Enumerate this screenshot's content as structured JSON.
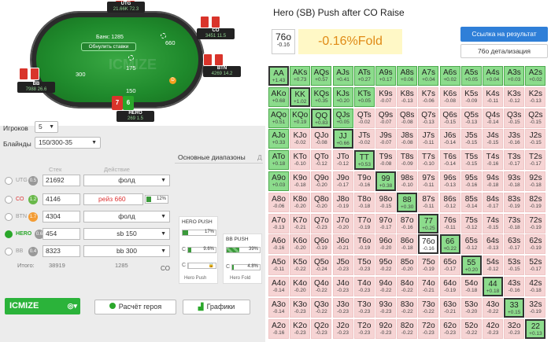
{
  "table": {
    "bank_label": "Банк: 1285",
    "reset_label": "Обнулить ставки",
    "watermark": "ICMIZE",
    "chip_values": {
      "co": "660",
      "hero": "150",
      "bb": "300",
      "center": "175"
    },
    "dealer_label": "D",
    "players": [
      {
        "id": "utg",
        "name": "UTG",
        "stack": "21.66K",
        "bb": "72.3"
      },
      {
        "id": "co",
        "name": "CO",
        "stack": "3451",
        "bb": "11.5"
      },
      {
        "id": "btn",
        "name": "BTN",
        "stack": "4269",
        "bb": "14.2"
      },
      {
        "id": "hero",
        "name": "HERO",
        "stack": "269",
        "bb": "1.5"
      },
      {
        "id": "bb",
        "name": "BB",
        "stack": "7988",
        "bb": "26.6"
      }
    ],
    "hero_cards": [
      "7",
      "6"
    ]
  },
  "controls": {
    "players_label": "Игроков",
    "players_value": "5",
    "blinds_label": "Блайнды",
    "blinds_value": "150/300-35",
    "stack_header": "Стек",
    "action_header": "Действие",
    "total_label": "Итого:",
    "total_stack": "38919",
    "total_pot": "1285",
    "rows": [
      {
        "pos": "UTG",
        "badge": "0.5",
        "stack": "21692",
        "action": "фолд",
        "pct": ""
      },
      {
        "pos": "CO",
        "badge": "1.2",
        "stack": "4146",
        "action": "рейз 660",
        "pct": "12%"
      },
      {
        "pos": "BTN",
        "badge": "1.7",
        "stack": "4304",
        "action": "фолд",
        "pct": ""
      },
      {
        "pos": "HERO",
        "badge": "0.6",
        "stack": "454",
        "action": "sb 150",
        "pct": ""
      },
      {
        "pos": "BB",
        "badge": "0.4",
        "stack": "8323",
        "action": "bb 300",
        "pct": ""
      }
    ],
    "co_footer": "CO"
  },
  "ranges": {
    "tab1": "Основные диапазоны",
    "tab2": "Д",
    "hero_push": {
      "title": "HERO PUSH",
      "top": "17%",
      "c_pct": "9.6%",
      "c_label": "C",
      "caption": "Hero Push"
    },
    "bb_push": {
      "title": "BB PUSH",
      "top": "39%",
      "c_pct": "4.8%",
      "c_label": "C",
      "caption": "Hero Fold"
    }
  },
  "buttons": {
    "icmize": "ICMIZE",
    "hero_calc": "Расчёт героя",
    "charts": "Графики"
  },
  "panel": {
    "title": "Hero (SB) Push after CO Raise",
    "hand": "76o",
    "hand_val": "-0.16",
    "ev": "-0.16%Fold",
    "link_btn": "Ссылка на результат",
    "detail_btn": "76o детализация"
  },
  "grid": [
    [
      [
        "AA",
        "+1.43",
        "p"
      ],
      [
        "AKs",
        "+0.73",
        "p"
      ],
      [
        "AQs",
        "+0.57",
        "p"
      ],
      [
        "AJs",
        "+0.41",
        "p"
      ],
      [
        "ATs",
        "+0.27",
        "p"
      ],
      [
        "A9s",
        "+0.17",
        "p"
      ],
      [
        "A8s",
        "+0.06",
        "p"
      ],
      [
        "A7s",
        "+0.04",
        "p"
      ],
      [
        "A6s",
        "+0.02",
        "p"
      ],
      [
        "A5s",
        "+0.05",
        "p"
      ],
      [
        "A4s",
        "+0.04",
        "p"
      ],
      [
        "A3s",
        "+0.03",
        "p"
      ],
      [
        "A2s",
        "+0.02",
        "p"
      ]
    ],
    [
      [
        "AKo",
        "+0.68",
        "p"
      ],
      [
        "KK",
        "+1.02",
        "p"
      ],
      [
        "KQs",
        "+0.35",
        "p"
      ],
      [
        "KJs",
        "+0.20",
        "p"
      ],
      [
        "KTs",
        "+0.05",
        "p"
      ],
      [
        "K9s",
        "-0.07",
        "f"
      ],
      [
        "K8s",
        "-0.13",
        "f"
      ],
      [
        "K7s",
        "-0.06",
        "f"
      ],
      [
        "K6s",
        "-0.08",
        "f"
      ],
      [
        "K5s",
        "-0.09",
        "f"
      ],
      [
        "K4s",
        "-0.11",
        "f"
      ],
      [
        "K3s",
        "-0.12",
        "f"
      ],
      [
        "K2s",
        "-0.13",
        "f"
      ]
    ],
    [
      [
        "AQo",
        "+0.51",
        "p"
      ],
      [
        "KQo",
        "+0.19",
        "p"
      ],
      [
        "QQ",
        "+0.83",
        "p"
      ],
      [
        "QJs",
        "+0.05",
        "p"
      ],
      [
        "QTs",
        "-0.02",
        "f"
      ],
      [
        "Q9s",
        "-0.07",
        "f"
      ],
      [
        "Q8s",
        "-0.08",
        "f"
      ],
      [
        "Q7s",
        "-0.13",
        "f"
      ],
      [
        "Q6s",
        "-0.15",
        "f"
      ],
      [
        "Q5s",
        "-0.13",
        "f"
      ],
      [
        "Q4s",
        "-0.14",
        "f"
      ],
      [
        "Q3s",
        "-0.15",
        "f"
      ],
      [
        "Q2s",
        "-0.15",
        "f"
      ]
    ],
    [
      [
        "AJo",
        "+0.33",
        "p"
      ],
      [
        "KJo",
        "-0.02",
        "f"
      ],
      [
        "QJo",
        "-0.08",
        "f"
      ],
      [
        "JJ",
        "+0.66",
        "p"
      ],
      [
        "JTs",
        "-0.02",
        "f"
      ],
      [
        "J9s",
        "-0.07",
        "f"
      ],
      [
        "J8s",
        "-0.08",
        "f"
      ],
      [
        "J7s",
        "-0.11",
        "f"
      ],
      [
        "J6s",
        "-0.14",
        "f"
      ],
      [
        "J5s",
        "-0.15",
        "f"
      ],
      [
        "J4s",
        "-0.15",
        "f"
      ],
      [
        "J3s",
        "-0.16",
        "f"
      ],
      [
        "J2s",
        "-0.15",
        "f"
      ]
    ],
    [
      [
        "ATo",
        "+0.18",
        "p"
      ],
      [
        "KTo",
        "-0.10",
        "f"
      ],
      [
        "QTo",
        "-0.12",
        "f"
      ],
      [
        "JTo",
        "-0.12",
        "f"
      ],
      [
        "TT",
        "+0.53",
        "p"
      ],
      [
        "T9s",
        "-0.08",
        "f"
      ],
      [
        "T8s",
        "-0.09",
        "f"
      ],
      [
        "T7s",
        "-0.10",
        "f"
      ],
      [
        "T6s",
        "-0.14",
        "f"
      ],
      [
        "T5s",
        "-0.15",
        "f"
      ],
      [
        "T4s",
        "-0.16",
        "f"
      ],
      [
        "T3s",
        "-0.17",
        "f"
      ],
      [
        "T2s",
        "-0.17",
        "f"
      ]
    ],
    [
      [
        "A9o",
        "+0.03",
        "p"
      ],
      [
        "K9o",
        "-0.18",
        "f"
      ],
      [
        "Q9o",
        "-0.20",
        "f"
      ],
      [
        "J9o",
        "-0.17",
        "f"
      ],
      [
        "T9o",
        "-0.16",
        "f"
      ],
      [
        "99",
        "+0.38",
        "p"
      ],
      [
        "98s",
        "-0.10",
        "f"
      ],
      [
        "97s",
        "-0.11",
        "f"
      ],
      [
        "96s",
        "-0.13",
        "f"
      ],
      [
        "95s",
        "-0.16",
        "f"
      ],
      [
        "94s",
        "-0.18",
        "f"
      ],
      [
        "93s",
        "-0.18",
        "f"
      ],
      [
        "92s",
        "-0.18",
        "f"
      ]
    ],
    [
      [
        "A8o",
        "-0.06",
        "f"
      ],
      [
        "K8o",
        "-0.20",
        "f"
      ],
      [
        "Q8o",
        "-0.20",
        "f"
      ],
      [
        "J8o",
        "-0.19",
        "f"
      ],
      [
        "T8o",
        "-0.18",
        "f"
      ],
      [
        "98o",
        "-0.15",
        "f"
      ],
      [
        "88",
        "+0.30",
        "p"
      ],
      [
        "87s",
        "-0.11",
        "f"
      ],
      [
        "86s",
        "-0.12",
        "f"
      ],
      [
        "85s",
        "-0.14",
        "f"
      ],
      [
        "84s",
        "-0.17",
        "f"
      ],
      [
        "83s",
        "-0.19",
        "f"
      ],
      [
        "82s",
        "-0.19",
        "f"
      ]
    ],
    [
      [
        "A7o",
        "-0.13",
        "f"
      ],
      [
        "K7o",
        "-0.21",
        "f"
      ],
      [
        "Q7o",
        "-0.23",
        "f"
      ],
      [
        "J7o",
        "-0.20",
        "f"
      ],
      [
        "T7o",
        "-0.19",
        "f"
      ],
      [
        "97o",
        "-0.17",
        "f"
      ],
      [
        "87o",
        "-0.16",
        "f"
      ],
      [
        "77",
        "+0.25",
        "p"
      ],
      [
        "76s",
        "-0.11",
        "f"
      ],
      [
        "75s",
        "-0.12",
        "f"
      ],
      [
        "74s",
        "-0.15",
        "f"
      ],
      [
        "73s",
        "-0.18",
        "f"
      ],
      [
        "72s",
        "-0.19",
        "f"
      ]
    ],
    [
      [
        "A6o",
        "-0.16",
        "f"
      ],
      [
        "K6o",
        "-0.20",
        "f"
      ],
      [
        "Q6o",
        "-0.19",
        "f"
      ],
      [
        "J6o",
        "-0.21",
        "f"
      ],
      [
        "T6o",
        "-0.19",
        "f"
      ],
      [
        "96o",
        "-0.20",
        "f"
      ],
      [
        "86o",
        "-0.18",
        "f"
      ],
      [
        "76o",
        "-0.16",
        "hl"
      ],
      [
        "66",
        "+0.22",
        "p"
      ],
      [
        "65s",
        "-0.12",
        "f"
      ],
      [
        "64s",
        "-0.13",
        "f"
      ],
      [
        "63s",
        "-0.17",
        "f"
      ],
      [
        "62s",
        "-0.19",
        "f"
      ]
    ],
    [
      [
        "A5o",
        "-0.11",
        "f"
      ],
      [
        "K5o",
        "-0.22",
        "f"
      ],
      [
        "Q5o",
        "-0.24",
        "f"
      ],
      [
        "J5o",
        "-0.23",
        "f"
      ],
      [
        "T5o",
        "-0.23",
        "f"
      ],
      [
        "95o",
        "-0.22",
        "f"
      ],
      [
        "85o",
        "-0.20",
        "f"
      ],
      [
        "75o",
        "-0.19",
        "f"
      ],
      [
        "65o",
        "-0.17",
        "f"
      ],
      [
        "55",
        "+0.20",
        "p"
      ],
      [
        "54s",
        "-0.12",
        "f"
      ],
      [
        "53s",
        "-0.15",
        "f"
      ],
      [
        "52s",
        "-0.17",
        "f"
      ]
    ],
    [
      [
        "A4o",
        "-0.14",
        "f"
      ],
      [
        "K4o",
        "-0.20",
        "f"
      ],
      [
        "Q4o",
        "-0.22",
        "f"
      ],
      [
        "J4o",
        "-0.23",
        "f"
      ],
      [
        "T4o",
        "-0.23",
        "f"
      ],
      [
        "94o",
        "-0.22",
        "f"
      ],
      [
        "84o",
        "-0.22",
        "f"
      ],
      [
        "74o",
        "-0.21",
        "f"
      ],
      [
        "64o",
        "-0.19",
        "f"
      ],
      [
        "54o",
        "-0.18",
        "f"
      ],
      [
        "44",
        "+0.18",
        "p"
      ],
      [
        "43s",
        "-0.16",
        "f"
      ],
      [
        "42s",
        "-0.18",
        "f"
      ]
    ],
    [
      [
        "A3o",
        "-0.14",
        "f"
      ],
      [
        "K3o",
        "-0.23",
        "f"
      ],
      [
        "Q3o",
        "-0.22",
        "f"
      ],
      [
        "J3o",
        "-0.23",
        "f"
      ],
      [
        "T3o",
        "-0.23",
        "f"
      ],
      [
        "93o",
        "-0.23",
        "f"
      ],
      [
        "83o",
        "-0.22",
        "f"
      ],
      [
        "73o",
        "-0.22",
        "f"
      ],
      [
        "63o",
        "-0.21",
        "f"
      ],
      [
        "53o",
        "-0.20",
        "f"
      ],
      [
        "43o",
        "-0.22",
        "f"
      ],
      [
        "33",
        "+0.15",
        "p"
      ],
      [
        "32s",
        "-0.19",
        "f"
      ]
    ],
    [
      [
        "A2o",
        "-0.16",
        "f"
      ],
      [
        "K2o",
        "-0.23",
        "f"
      ],
      [
        "Q2o",
        "-0.23",
        "f"
      ],
      [
        "J2o",
        "-0.23",
        "f"
      ],
      [
        "T2o",
        "-0.23",
        "f"
      ],
      [
        "92o",
        "-0.23",
        "f"
      ],
      [
        "82o",
        "-0.22",
        "f"
      ],
      [
        "72o",
        "-0.23",
        "f"
      ],
      [
        "62o",
        "-0.23",
        "f"
      ],
      [
        "52o",
        "-0.22",
        "f"
      ],
      [
        "42o",
        "-0.23",
        "f"
      ],
      [
        "32o",
        "-0.23",
        "f"
      ],
      [
        "22",
        "+0.13",
        "p"
      ]
    ]
  ],
  "colors": {
    "push": "#8cdc8c",
    "fold": "#f6d4d4",
    "accent": "#2bb33a",
    "blue": "#2f7fd8",
    "ev": "#e08a16"
  }
}
